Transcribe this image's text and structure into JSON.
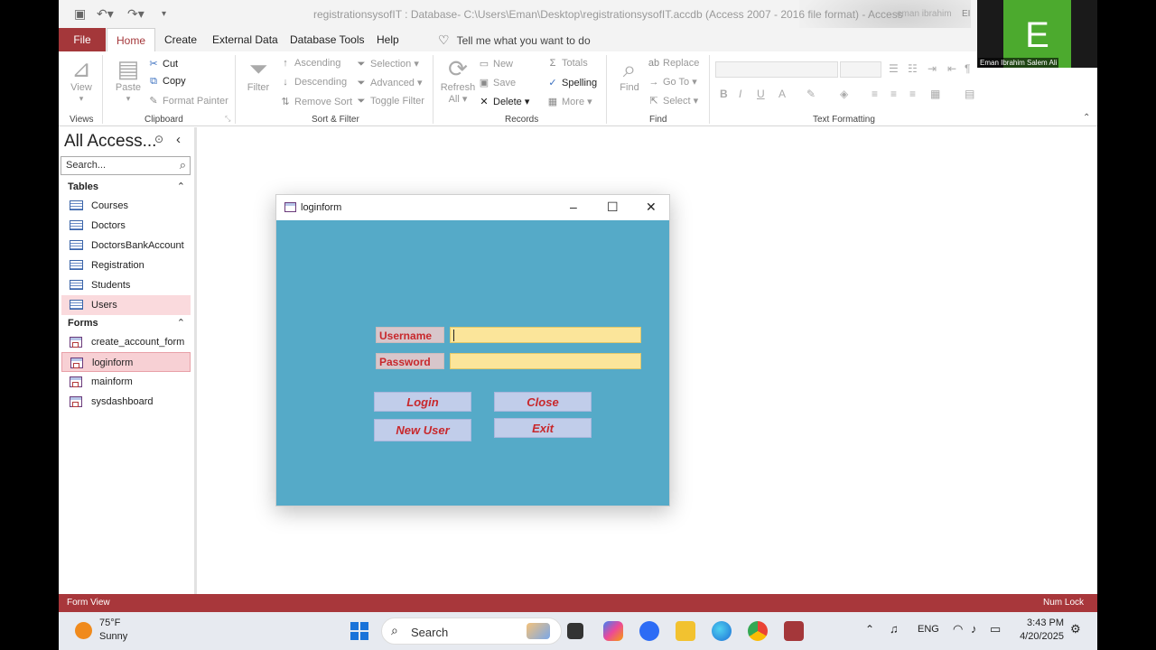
{
  "window": {
    "title": "registrationsysofIT : Database- C:\\Users\\Eman\\Desktop\\registrationsysofIT.accdb (Access 2007 - 2016 file format) - Access",
    "user_name": "eman ibrahim",
    "user_initials": "EI"
  },
  "tabs": [
    "File",
    "Home",
    "Create",
    "External Data",
    "Database Tools",
    "Help"
  ],
  "tell_me": "Tell me what you want to do",
  "ribbon": {
    "views": {
      "label": "Views",
      "view": "View"
    },
    "clipboard": {
      "label": "Clipboard",
      "paste": "Paste",
      "cut": "Cut",
      "copy": "Copy",
      "format_painter": "Format Painter"
    },
    "sort_filter": {
      "label": "Sort & Filter",
      "filter": "Filter",
      "ascending": "Ascending",
      "descending": "Descending",
      "remove_sort": "Remove Sort",
      "selection": "Selection",
      "advanced": "Advanced",
      "toggle_filter": "Toggle Filter"
    },
    "records": {
      "label": "Records",
      "refresh": "Refresh",
      "refresh_all": "All",
      "new": "New",
      "save": "Save",
      "delete": "Delete",
      "totals": "Totals",
      "spelling": "Spelling",
      "more": "More"
    },
    "find": {
      "label": "Find",
      "find": "Find",
      "replace": "Replace",
      "go_to": "Go To",
      "select": "Select"
    },
    "text_formatting": {
      "label": "Text Formatting",
      "bold": "B",
      "italic": "I",
      "underline": "U",
      "font_color": "A"
    }
  },
  "nav": {
    "title": "All Access...",
    "search_placeholder": "Search...",
    "sections": [
      {
        "name": "Tables",
        "items": [
          "Courses",
          "Doctors",
          "DoctorsBankAccount",
          "Registration",
          "Students",
          "Users"
        ]
      },
      {
        "name": "Forms",
        "items": [
          "create_account_form",
          "loginform",
          "mainform",
          "sysdashboard"
        ]
      }
    ]
  },
  "login_form": {
    "title": "loginform",
    "username_label": "Username",
    "password_label": "Password",
    "username_value": "",
    "password_value": "",
    "login_button": "Login",
    "close_button": "Close",
    "new_user_button": "New User",
    "exit_button": "Exit",
    "background_color": "#55aac8"
  },
  "status_bar": {
    "left": "Form View",
    "right": "Num Lock"
  },
  "video_tile": {
    "initial": "E",
    "name": "Eman Ibrahim Salem Ali"
  },
  "taskbar": {
    "temperature": "75°F",
    "condition": "Sunny",
    "search": "Search",
    "language": "ENG",
    "time": "3:43 PM",
    "date": "4/20/2025"
  },
  "colors": {
    "access_accent": "#a4373a",
    "status_bar": "#a8373b",
    "form_label_text": "#c8282c",
    "field_fill": "#fbe59a",
    "button_fill": "#c1cdea"
  }
}
